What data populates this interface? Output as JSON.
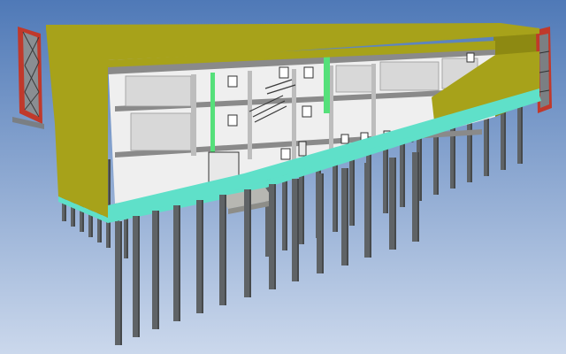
{
  "viewer": {
    "view_type": "bim-3d-section-view",
    "sky_top_color": "#4f79b7",
    "sky_bottom_color": "#cbd8ec",
    "facade_color": "#a7a21a",
    "facade_dark_color": "#8d8912",
    "plinth_color": "#5fe0c9",
    "pile_color": "#5f6366",
    "pile_dark_color": "#46494b",
    "roof_color": "#d9d9d4",
    "section_wall_color": "#efefef",
    "section_cut_color": "#8a8a8a",
    "stair_tower_color": "#c0392b",
    "accent_green": "#55e07a"
  }
}
